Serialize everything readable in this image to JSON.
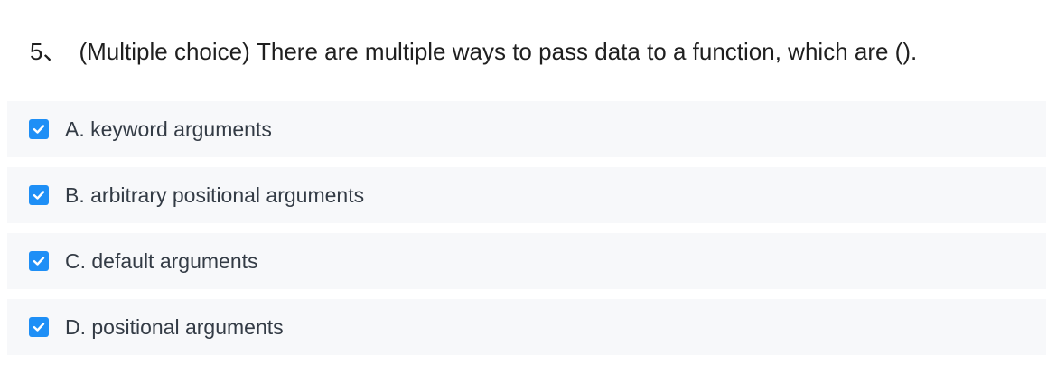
{
  "question": {
    "number": "5、",
    "text": "(Multiple choice) There are multiple ways to pass data to a function, which are ()."
  },
  "options": [
    {
      "label": "A. keyword arguments",
      "checked": true
    },
    {
      "label": "B. arbitrary positional arguments",
      "checked": true
    },
    {
      "label": "C. default arguments",
      "checked": true
    },
    {
      "label": "D. positional arguments",
      "checked": true
    }
  ],
  "colors": {
    "checkbox": "#1e8ff6",
    "option_background": "#f7f8fa",
    "text": "#333b45"
  }
}
